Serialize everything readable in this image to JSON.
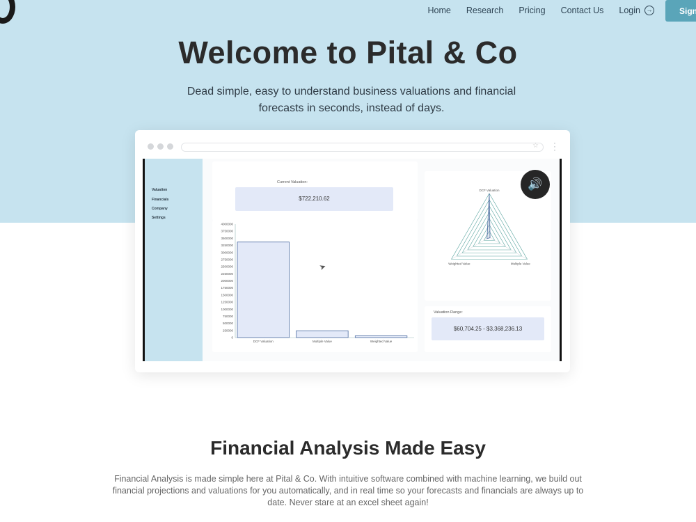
{
  "nav": {
    "items": [
      "Home",
      "Research",
      "Pricing",
      "Contact Us"
    ],
    "login": "Login",
    "signup": "Sign"
  },
  "hero": {
    "title": "Welcome to Pital & Co",
    "subtitle": "Dead simple, easy to understand business valuations and financial forecasts in seconds, instead of days."
  },
  "app": {
    "sidebar": [
      "Valuation",
      "Financials",
      "Company",
      "Settings"
    ],
    "current_valuation_label": "Current Valuation:",
    "current_valuation_value": "$722,210.62",
    "valuation_range_label": "Valuation Range:",
    "valuation_range_value": "$60,704.25 - $3,368,236.13"
  },
  "chart_data": [
    {
      "type": "bar",
      "categories": [
        "DCF Valuation",
        "Multiple Value",
        "Weighted Value"
      ],
      "values": [
        3368236,
        240000,
        60704
      ],
      "ylim": [
        0,
        4000000
      ],
      "yticks": [
        0,
        250000,
        500000,
        750000,
        1000000,
        1250000,
        1500000,
        1750000,
        2000000,
        2250000,
        2500000,
        2750000,
        3000000,
        3250000,
        3500000,
        3750000,
        4000000
      ],
      "color": "#e3e9f8",
      "border_color": "#4a6aa0"
    },
    {
      "type": "radar",
      "axes": [
        "DCF Valuation",
        "Weighted Value",
        "Multiple Value"
      ],
      "rings": 7,
      "series": [
        {
          "values": [
            1.0,
            0.06,
            0.02
          ]
        }
      ],
      "color": "#5aa5a0"
    }
  ],
  "section": {
    "title": "Financial Analysis Made Easy",
    "body": "Financial Analysis is made simple here at Pital & Co. With intuitive software combined with machine learning, we build out financial projections and valuations for you automatically, and in real time so your forecasts and financials are always up to date. Never stare at an excel sheet again!"
  },
  "colors": {
    "hero_bg": "#c6e3ef",
    "accent": "#5aa5b9",
    "text_dark": "#2b2b2b"
  },
  "icons": {
    "login": "login-arrow-icon",
    "sound": "speaker-icon",
    "cursor": "mouse-pointer-icon",
    "star": "bookmark-star-icon",
    "menu": "kebab-menu-icon"
  }
}
